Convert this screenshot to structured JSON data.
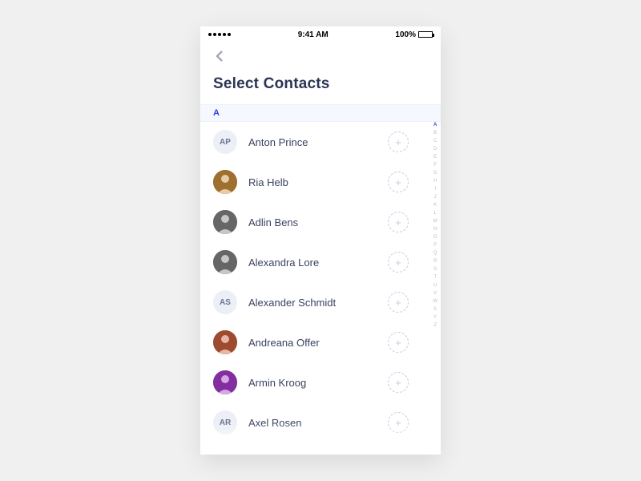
{
  "statusbar": {
    "time": "9:41 AM",
    "battery_pct": "100%"
  },
  "header": {
    "title": "Select Contacts"
  },
  "section_letter": "A",
  "contacts": [
    {
      "name": "Anton Prince",
      "initials": "AP",
      "has_photo": false,
      "photo_hue": 0
    },
    {
      "name": "Ria Helb",
      "initials": "",
      "has_photo": true,
      "photo_hue": 35
    },
    {
      "name": "Adlin Bens",
      "initials": "",
      "has_photo": true,
      "photo_hue": 0
    },
    {
      "name": "Alexandra Lore",
      "initials": "",
      "has_photo": true,
      "photo_hue": 0
    },
    {
      "name": "Alexander Schmidt",
      "initials": "AS",
      "has_photo": false,
      "photo_hue": 0
    },
    {
      "name": "Andreana Offer",
      "initials": "",
      "has_photo": true,
      "photo_hue": 15
    },
    {
      "name": "Armin Kroog",
      "initials": "",
      "has_photo": true,
      "photo_hue": 285
    },
    {
      "name": "Axel Rosen",
      "initials": "AR",
      "has_photo": false,
      "photo_hue": 0
    }
  ],
  "alpha_index": [
    "A",
    "B",
    "C",
    "D",
    "E",
    "F",
    "G",
    "H",
    "I",
    "J",
    "K",
    "L",
    "M",
    "N",
    "O",
    "P",
    "Q",
    "R",
    "S",
    "T",
    "U",
    "V",
    "W",
    "X",
    "Y",
    "Z"
  ],
  "alpha_active": "A",
  "add_glyph": "+"
}
